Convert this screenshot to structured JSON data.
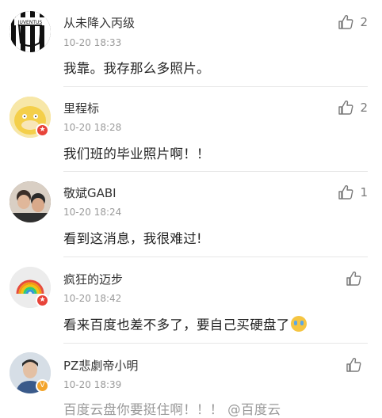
{
  "comments": [
    {
      "username": "从未降入丙级",
      "time": "10-20 18:33",
      "text": "我靠。我存那么多照片。",
      "likes": "2",
      "avatar": "juventus-logo-avatar",
      "badge": null
    },
    {
      "username": "里程标",
      "time": "10-20 18:28",
      "text": "我们班的毕业照片啊！！",
      "likes": "2",
      "avatar": "psyduck-avatar",
      "badge": "red"
    },
    {
      "username": "敬斌GABI",
      "time": "10-20 18:24",
      "text": "看到这消息，我很难过!",
      "likes": "1",
      "avatar": "photo-avatar",
      "badge": null
    },
    {
      "username": "疯狂的迈步",
      "time": "10-20 18:42",
      "text": "看来百度也差不多了，要自己买硬盘了",
      "likes": "",
      "avatar": "rainbow-avatar",
      "badge": "red"
    },
    {
      "username": "PZ悲劇帝小明",
      "time": "10-20 18:39",
      "text": "百度云盘你要挺住啊！！！ @百度云",
      "likes": "",
      "avatar": "portrait-avatar",
      "badge": "gold-v"
    }
  ],
  "colors": {
    "badge_red": "#e8443a",
    "badge_gold": "#f3a42b",
    "meta_gray": "#9a9a9a",
    "link_blue": "#5b7fbf"
  }
}
